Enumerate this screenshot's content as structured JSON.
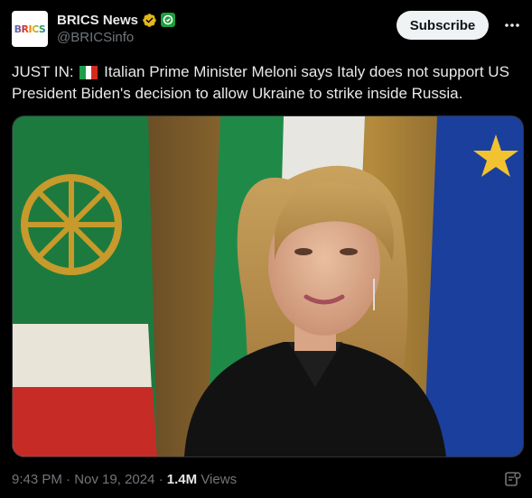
{
  "account": {
    "avatar_text": "BRICS",
    "display_name": "BRICS News",
    "handle": "@BRICSinfo",
    "verified_badge": "gold-check-icon",
    "affiliate_badge": "affiliate-icon"
  },
  "actions": {
    "subscribe_label": "Subscribe",
    "more_icon": "more-icon"
  },
  "tweet": {
    "prefix": "JUST IN:",
    "flag_icon": "italy-flag-icon",
    "body": "Italian Prime Minister Meloni says Italy does not support US President Biden's decision to allow Ukraine to strike inside Russia."
  },
  "meta": {
    "time": "9:43 PM",
    "separator": "·",
    "date": "Nov 19, 2024",
    "views_count": "1.4M",
    "views_label": "Views"
  },
  "colors": {
    "background": "#000000",
    "text": "#e7e9ea",
    "secondary": "#71767b",
    "gold_badge": "#e2b719",
    "affiliate_green": "#1e9e3e"
  }
}
